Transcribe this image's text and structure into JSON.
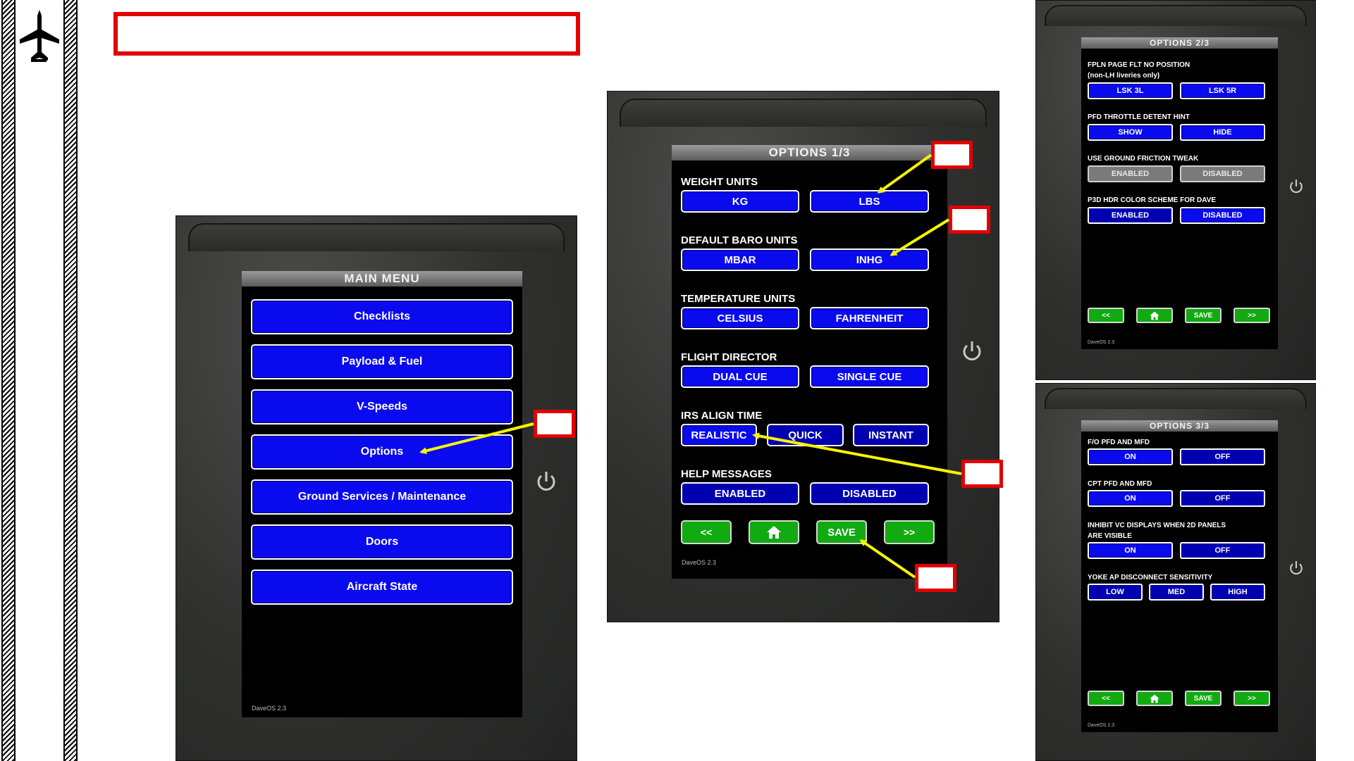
{
  "sidebar": {
    "logo_icon": "airplane-icon"
  },
  "main_menu": {
    "title": "MAIN MENU",
    "items": [
      "Checklists",
      "Payload & Fuel",
      "V-Speeds",
      "Options",
      "Ground Services / Maintenance",
      "Doors",
      "Aircraft State"
    ],
    "version": "DaveOS 2.3"
  },
  "options1": {
    "title": "OPTIONS 1/3",
    "weight": {
      "label": "WEIGHT UNITS",
      "opt1": "KG",
      "opt2": "LBS"
    },
    "baro": {
      "label": "DEFAULT BARO UNITS",
      "opt1": "MBAR",
      "opt2": "INHG"
    },
    "temp": {
      "label": "TEMPERATURE UNITS",
      "opt1": "CELSIUS",
      "opt2": "FAHRENHEIT"
    },
    "fd": {
      "label": "FLIGHT DIRECTOR",
      "opt1": "DUAL CUE",
      "opt2": "SINGLE CUE"
    },
    "irs": {
      "label": "IRS ALIGN TIME",
      "opt1": "REALISTIC",
      "opt2": "QUICK",
      "opt3": "INSTANT"
    },
    "help": {
      "label": "HELP MESSAGES",
      "opt1": "ENABLED",
      "opt2": "DISABLED"
    },
    "nav": {
      "prev": "<<",
      "home_icon": "home-icon",
      "save": "SAVE",
      "next": ">>"
    },
    "version": "DaveOS 2.3"
  },
  "options2": {
    "title": "OPTIONS 2/3",
    "fpln": {
      "label": "FPLN PAGE FLT NO POSITION",
      "sublabel": "(non-LH liveries only)",
      "opt1": "LSK 3L",
      "opt2": "LSK 5R"
    },
    "pfd": {
      "label": "PFD THROTTLE DETENT HINT",
      "opt1": "SHOW",
      "opt2": "HIDE"
    },
    "friction": {
      "label": "USE GROUND FRICTION TWEAK",
      "opt1": "ENABLED",
      "opt2": "DISABLED"
    },
    "hdr": {
      "label": "P3D HDR COLOR SCHEME FOR DAVE",
      "opt1": "ENABLED",
      "opt2": "DISABLED"
    },
    "nav": {
      "prev": "<<",
      "save": "SAVE",
      "next": ">>"
    },
    "version": "DaveOS 2.3"
  },
  "options3": {
    "title": "OPTIONS 3/3",
    "fo": {
      "label": "F/O PFD AND MFD",
      "opt1": "ON",
      "opt2": "OFF"
    },
    "cpt": {
      "label": "CPT PFD AND MFD",
      "opt1": "ON",
      "opt2": "OFF"
    },
    "inhibit": {
      "label": "INHIBIT VC DISPLAYS WHEN 2D PANELS",
      "label2": "ARE VISIBLE",
      "opt1": "ON",
      "opt2": "OFF"
    },
    "yoke": {
      "label": "YOKE AP DISCONNECT SENSITIVITY",
      "opt1": "LOW",
      "opt2": "MED",
      "opt3": "HIGH"
    },
    "nav": {
      "prev": "<<",
      "save": "SAVE",
      "next": ">>"
    },
    "version": "DaveOS 2.3"
  },
  "colors": {
    "button_blue": "#0a0aee",
    "nav_green": "#11aa11",
    "callout_red": "#e30000",
    "arrow_yellow": "#f5f500"
  }
}
